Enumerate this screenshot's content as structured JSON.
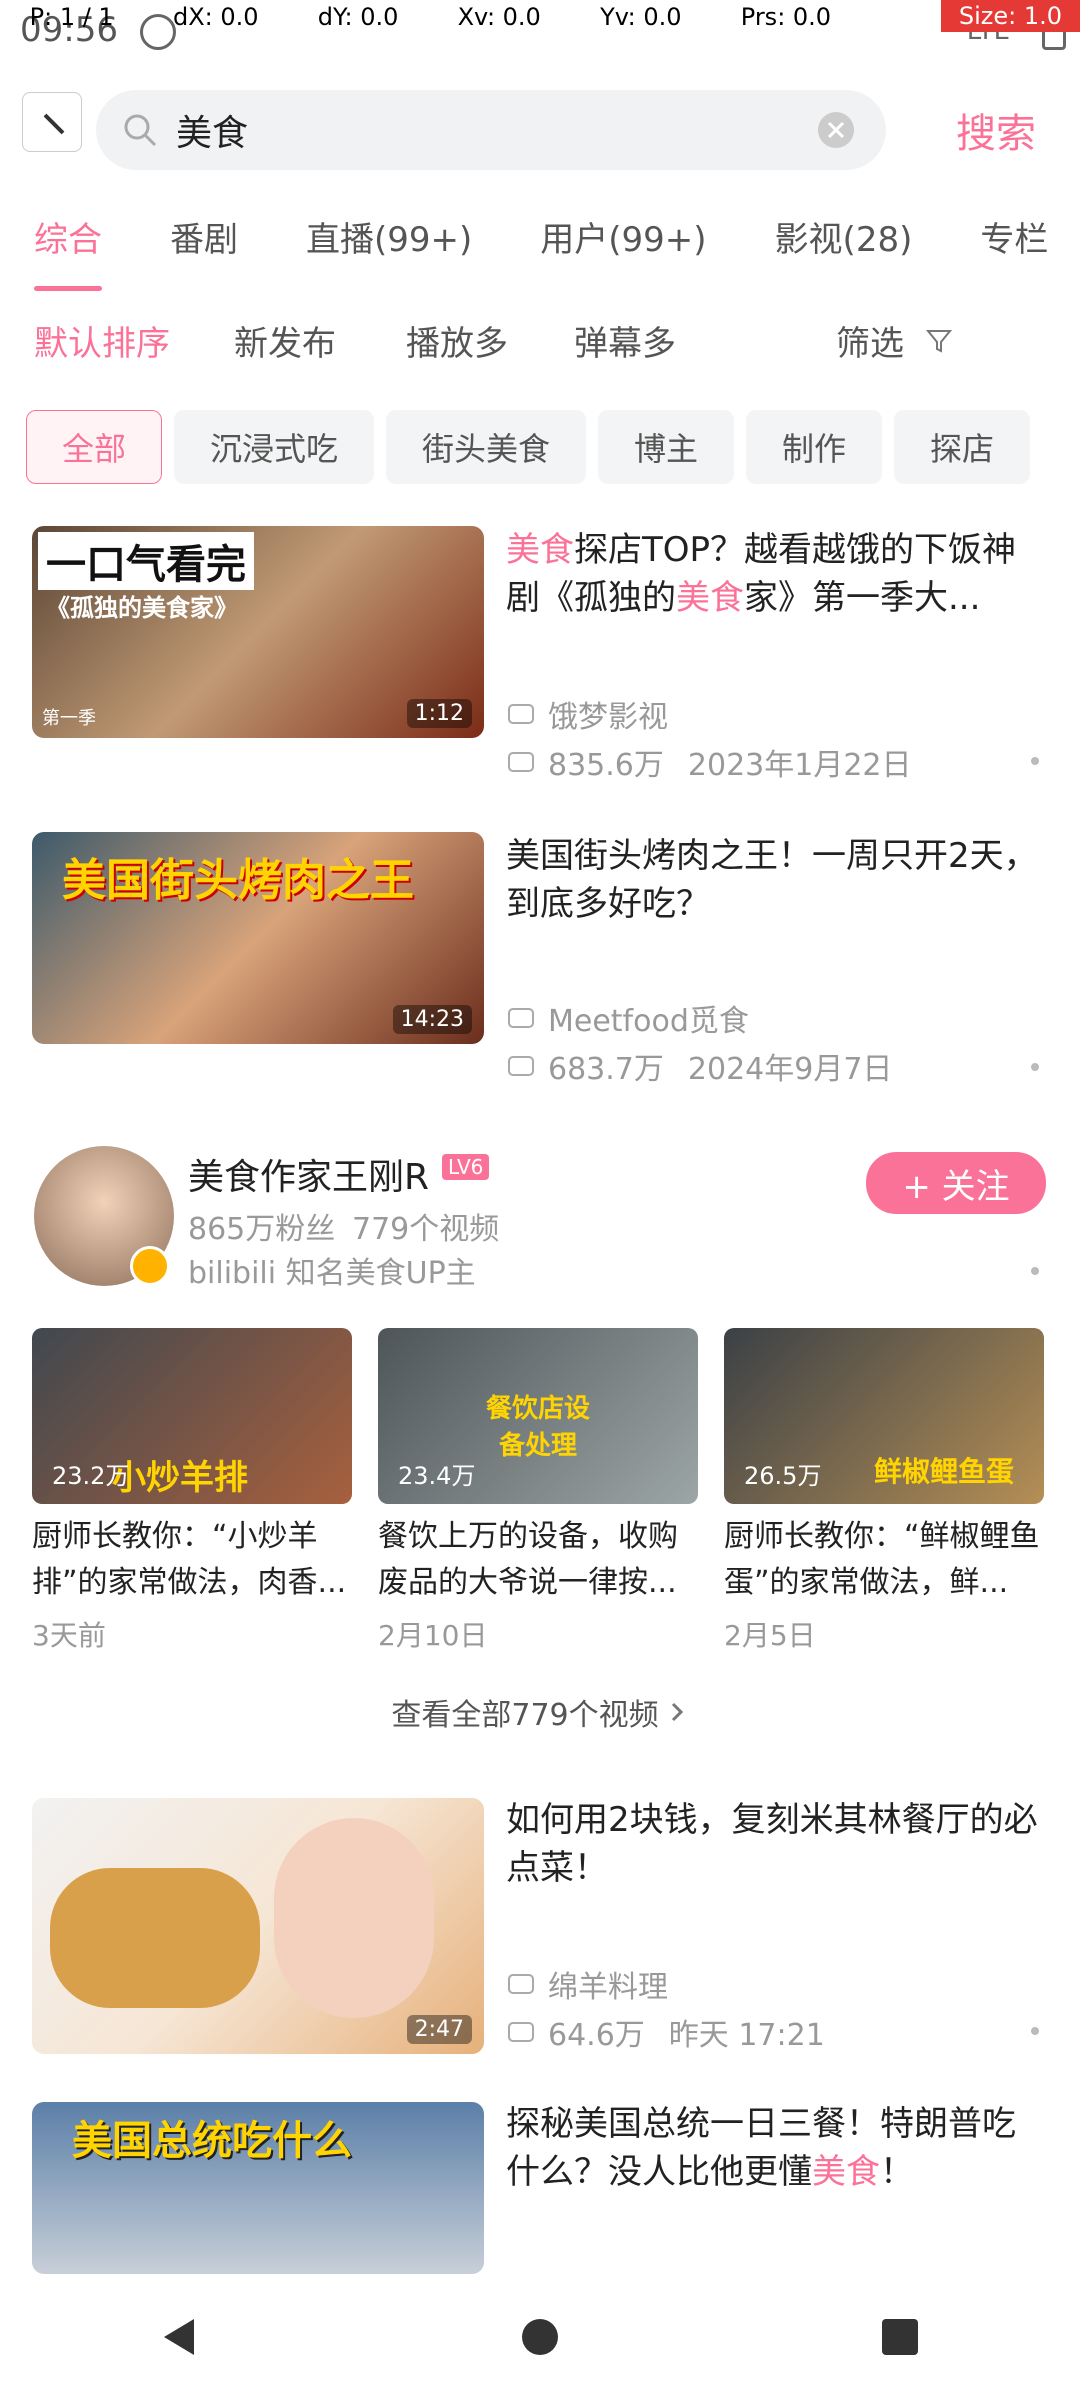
{
  "status": {
    "time": "09:56",
    "network": "LTE"
  },
  "debug": {
    "pointer": "P: 1 / 1",
    "dx": "dX: 0.0",
    "dy": "dY: 0.0",
    "xv": "Xv: 0.0",
    "yv": "Yv: 0.0",
    "prs": "Prs: 0.0",
    "size": "Size: 1.0"
  },
  "search": {
    "query": "美食",
    "button": "搜索"
  },
  "tabs": [
    "综合",
    "番剧",
    "直播(99+)",
    "用户(99+)",
    "影视(28)",
    "专栏"
  ],
  "sort": [
    "默认排序",
    "新发布",
    "播放多",
    "弹幕多"
  ],
  "filter_label": "筛选",
  "chips": [
    "全部",
    "沉浸式吃",
    "街头美食",
    "博主",
    "制作",
    "探店"
  ],
  "results": [
    {
      "thumb_text": "一口气看完",
      "thumb_sub": "《孤独的美食家》",
      "thumb_tag": "第一季",
      "title_hl": "美食",
      "title_rest": "探店TOP？越看越饿的下饭神剧《孤独的",
      "title_hl2": "美食",
      "title_tail": "家》第一季大...",
      "uploader": "饿梦影视",
      "views": "835.6万",
      "date": "2023年1月22日",
      "dur": "1:12"
    },
    {
      "thumb_text": "美国街头烤肉之王",
      "title": "美国街头烤肉之王！一周只开2天，到底多好吃？",
      "uploader": "Meetfood觅食",
      "views": "683.7万",
      "date": "2024年9月7日",
      "dur": "14:23"
    }
  ],
  "user": {
    "name": "美食作家王刚R",
    "badge": "LV6",
    "fans": "865万粉丝",
    "videos": "779个视频",
    "desc": "bilibili 知名美食UP主",
    "follow": "+ 关注"
  },
  "user_videos": [
    {
      "views": "23.2万",
      "title": "厨师长教你：“小炒羊排”的家常做法，肉香...",
      "date": "3天前",
      "overlay": "小炒羊排"
    },
    {
      "views": "23.4万",
      "title": "餐饮上万的设备，收购废品的大爷说一律按...",
      "date": "2月10日",
      "overlay": "餐饮店设备处理"
    },
    {
      "views": "26.5万",
      "title": "厨师长教你：“鲜椒鲤鱼蛋”的家常做法，鲜...",
      "date": "2月5日",
      "overlay": "鲜椒鲤鱼蛋"
    }
  ],
  "see_all": "查看全部779个视频",
  "results2": [
    {
      "title": "如何用2块钱，复刻米其林餐厅的必点菜！",
      "uploader": "绵羊料理",
      "views": "64.6万",
      "date": "昨天 17:21",
      "dur": "2:47"
    },
    {
      "thumb_text": "美国总统吃什么",
      "title_a": "探秘美国总统一日三餐！特朗普吃什么？没人比他更懂",
      "title_hl": "美食",
      "title_b": "！"
    }
  ],
  "colors": {
    "accent": "#fb7299",
    "muted": "#999999"
  }
}
